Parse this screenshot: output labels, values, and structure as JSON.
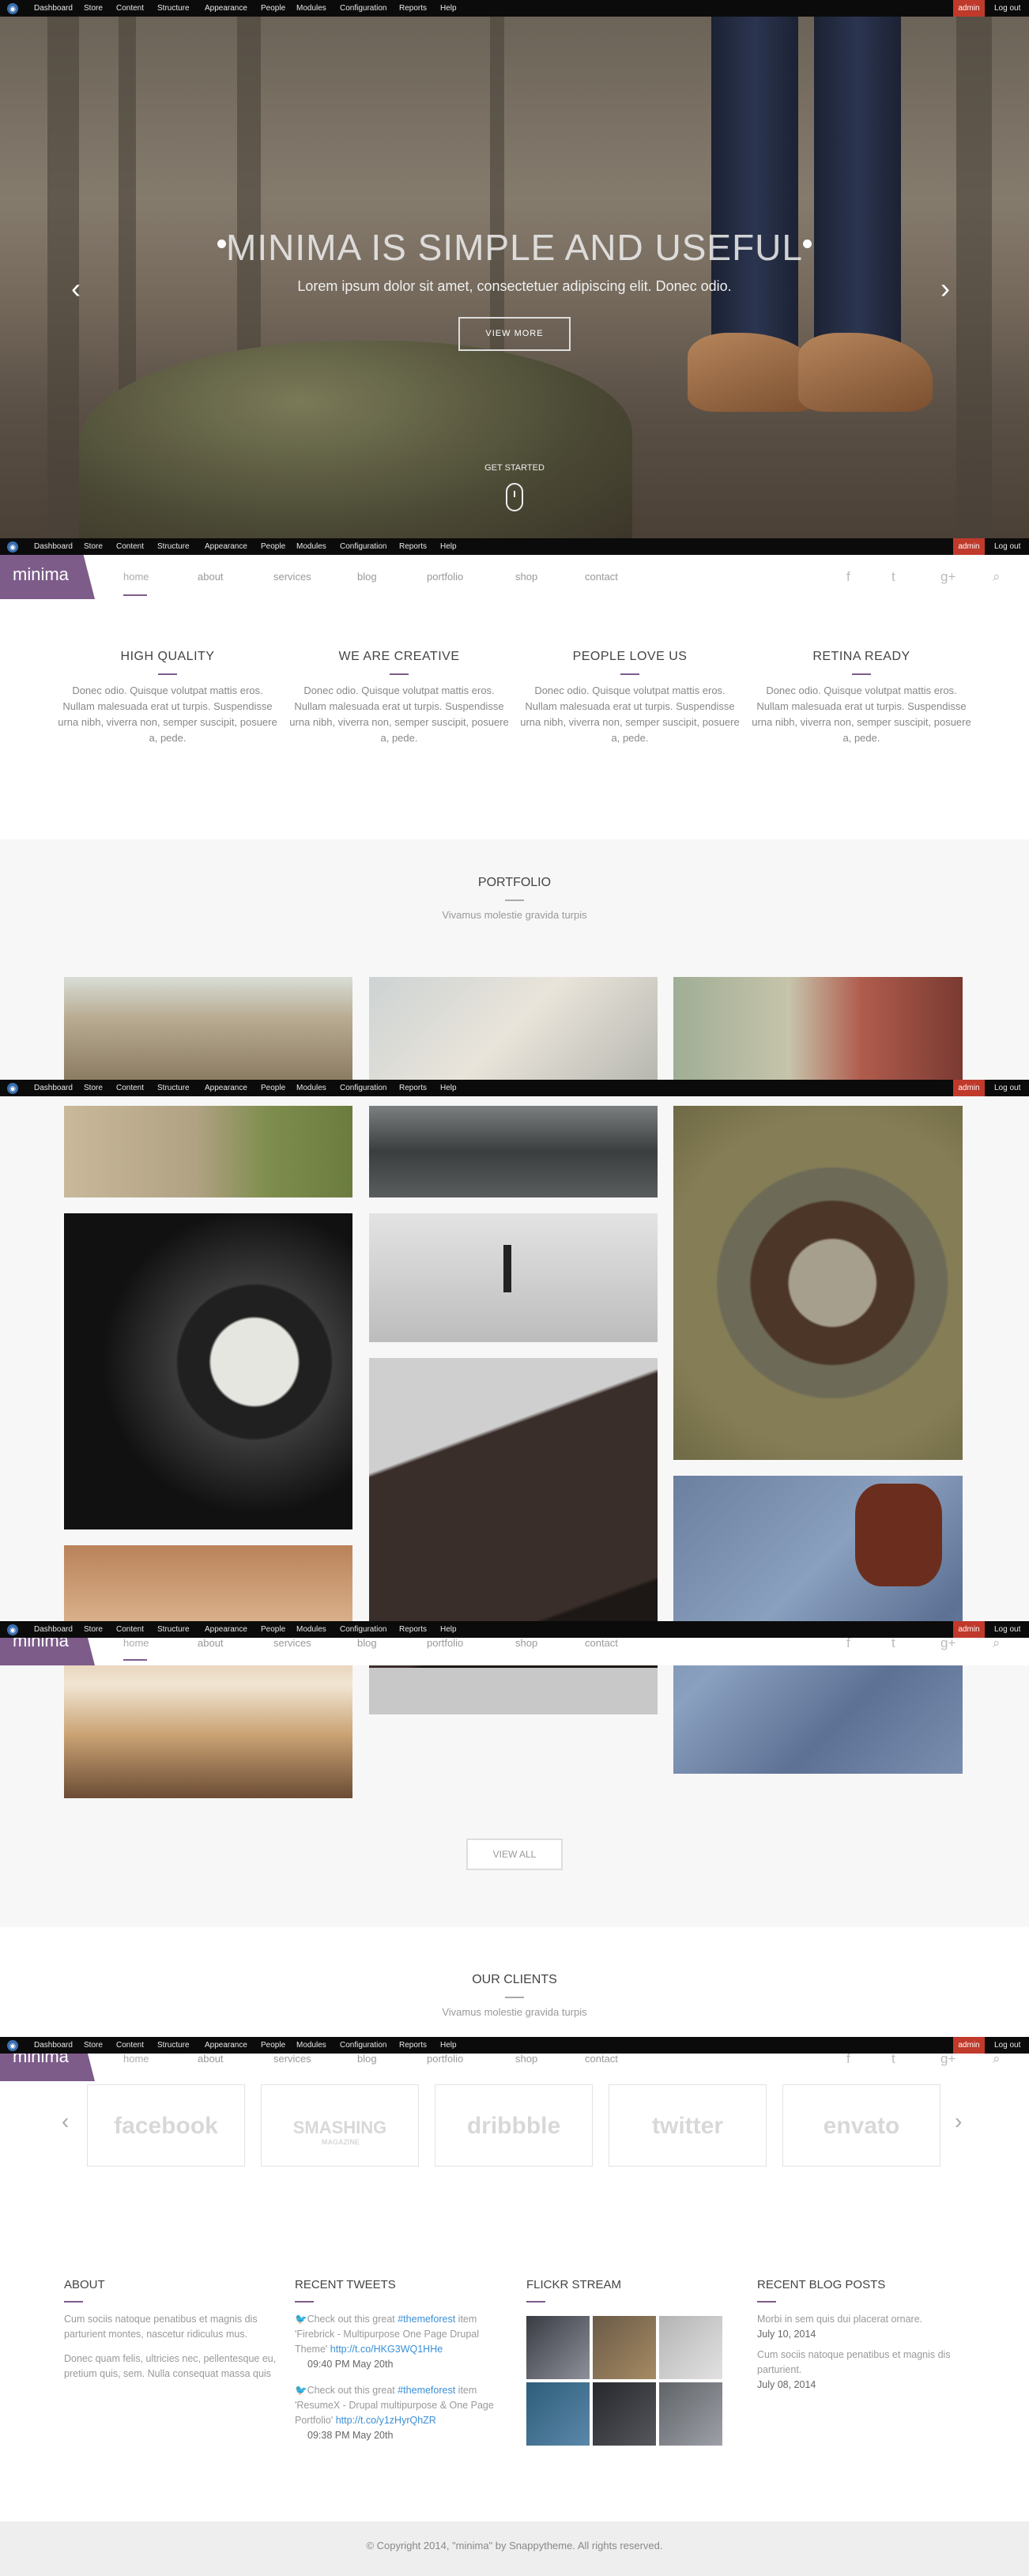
{
  "admin_bar": {
    "menu": [
      "Dashboard",
      "Store",
      "Content",
      "Structure",
      "Appearance",
      "People",
      "Modules",
      "Configuration",
      "Reports",
      "Help"
    ],
    "user": "admin",
    "logout": "Log out"
  },
  "hero": {
    "title": "MINIMA IS SIMPLE AND USEFUL",
    "subtitle": "Lorem ipsum dolor sit amet, consectetuer adipiscing elit. Donec odio.",
    "button": "VIEW MORE",
    "get_started": "GET STARTED"
  },
  "header": {
    "logo": "minima",
    "nav": [
      "home",
      "about",
      "services",
      "blog",
      "portfolio",
      "shop",
      "contact"
    ],
    "social": [
      "facebook-icon",
      "twitter-icon",
      "google-plus-icon",
      "search-icon"
    ]
  },
  "features": [
    {
      "title": "HIGH QUALITY",
      "text": "Donec odio. Quisque volutpat mattis eros. Nullam malesuada erat ut turpis. Suspendisse urna nibh, viverra non, semper suscipit, posuere a, pede."
    },
    {
      "title": "WE ARE CREATIVE",
      "text": "Donec odio. Quisque volutpat mattis eros. Nullam malesuada erat ut turpis. Suspendisse urna nibh, viverra non, semper suscipit, posuere a, pede."
    },
    {
      "title": "PEOPLE LOVE US",
      "text": "Donec odio. Quisque volutpat mattis eros. Nullam malesuada erat ut turpis. Suspendisse urna nibh, viverra non, semper suscipit, posuere a, pede."
    },
    {
      "title": "RETINA READY",
      "text": "Donec odio. Quisque volutpat mattis eros. Nullam malesuada erat ut turpis. Suspendisse urna nibh, viverra non, semper suscipit, posuere a, pede."
    }
  ],
  "portfolio": {
    "title": "PORTFOLIO",
    "subtitle": "Vivamus molestie gravida turpis",
    "view_all": "VIEW ALL"
  },
  "clients": {
    "title": "OUR CLIENTS",
    "subtitle": "Vivamus molestie gravida turpis",
    "logos": [
      "facebook",
      "SMASHING",
      "dribbble",
      "twitter",
      "envato"
    ],
    "logo_sub": "MAGAZINE"
  },
  "footer": {
    "about": {
      "title": "ABOUT",
      "p1": "Cum sociis natoque penatibus et magnis dis parturient montes, nascetur ridiculus mus.",
      "p2": "Donec quam felis, ultricies nec, pellentesque eu, pretium quis, sem. Nulla consequat massa quis"
    },
    "tweets": {
      "title": "RECENT TWEETS",
      "items": [
        {
          "pre": "Check out this great ",
          "tag": "#themeforest",
          "mid": " item 'Firebrick - Multipurpose One Page Drupal Theme' ",
          "link": "http://t.co/HKG3WQ1HHe",
          "time": "09:40 PM May 20th"
        },
        {
          "pre": "Check out this great ",
          "tag": "#themeforest",
          "mid": " item 'ResumeX - Drupal multipurpose & One Page Portfolio' ",
          "link": "http://t.co/y1zHyrQhZR",
          "time": "09:38 PM May 20th"
        }
      ]
    },
    "flickr": {
      "title": "FLICKR STREAM"
    },
    "blog": {
      "title": "RECENT BLOG POSTS",
      "items": [
        {
          "text": "Morbi in sem quis dui placerat ornare.",
          "date": "July 10, 2014"
        },
        {
          "text": "Cum sociis natoque penatibus et magnis dis parturient.",
          "date": "July 08, 2014"
        }
      ]
    }
  },
  "copyright": "© Copyright 2014, \"minima\" by Snappytheme. All rights reserved.",
  "colors": {
    "accent": "#7d5c8a",
    "admin": "#c0392b",
    "link": "#3a8fd8"
  }
}
